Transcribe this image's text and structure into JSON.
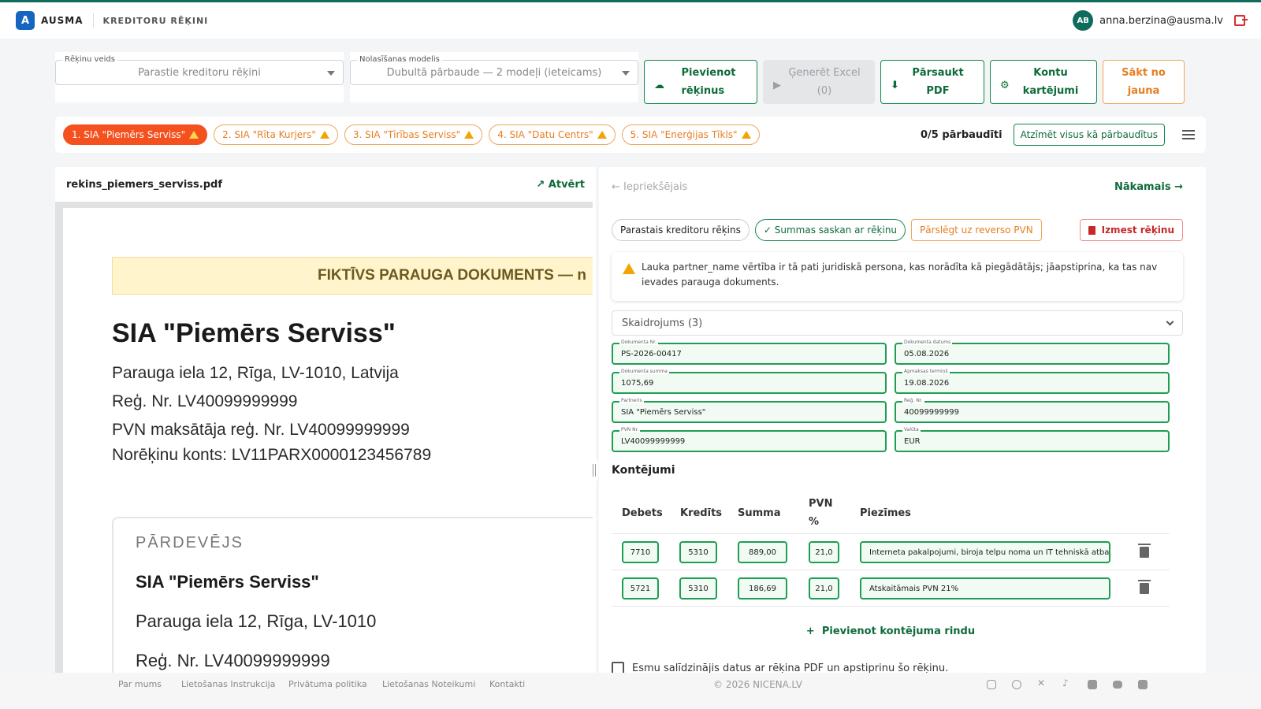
{
  "app": {
    "logo_letter": "A",
    "brand": "AUSMA",
    "section": "KREDITORU RĒĶINI",
    "user_initials": "AB",
    "user_email": "anna.berzina@ausma.lv"
  },
  "toolbar": {
    "invoice_type_label": "Rēķinu veids",
    "invoice_type_value": "Parastie kreditoru rēķini",
    "model_label": "Nolasīšanas modelis",
    "model_value": "Dubultā pārbaude — 2 modeļi (ieteicams)",
    "add_invoices_l1": "Pievienot",
    "add_invoices_l2": "rēķinus",
    "export_excel_l1": "Ģenerēt Excel",
    "export_excel_l2": "(0)",
    "reload_pdf_l1": "Pārsaukt",
    "reload_pdf_l2": "PDF",
    "account_rules_l1": "Kontu",
    "account_rules_l2": "kartējumi",
    "restart_l1": "Sākt no",
    "restart_l2": "jauna"
  },
  "invoice_tabs": [
    {
      "label": "1. SIA \"Piemērs Serviss\"",
      "active": true
    },
    {
      "label": "2. SIA \"Rīta Kurjers\"",
      "active": false
    },
    {
      "label": "3. SIA \"Tīrības Serviss\"",
      "active": false
    },
    {
      "label": "4. SIA \"Datu Centrs\"",
      "active": false
    },
    {
      "label": "5. SIA \"Enerģijas Tīkls\"",
      "active": false
    }
  ],
  "progress": "0/5 pārbaudīti",
  "mark_all": "Atzīmēt visus kā pārbaudītus",
  "pdf": {
    "filename": "rekins_piemers_serviss.pdf",
    "open": "Atvērt",
    "banner": "FIKTĪVS PARAUGA DOKUMENTS — n",
    "title": "SIA \"Piemērs Serviss\"",
    "lines": [
      "Parauga iela 12, Rīga, LV-1010, Latvija",
      "Reģ. Nr. LV40099999999",
      "PVN maksātāja reģ. Nr. LV40099999999",
      "Norēķinu konts: LV11PARX0000123456789"
    ],
    "seller_label": "PĀRDEVĒJS",
    "seller_name": "SIA \"Piemērs Serviss\"",
    "seller_address": "Parauga iela 12, Rīga, LV-1010",
    "seller_reg": "Reģ. Nr. LV40099999999"
  },
  "form": {
    "prev": "Iepriekšējais",
    "next": "Nākamais",
    "chip_type": "Parastais kreditoru rēķins",
    "chip_sums": "Summas saskan ar rēķinu",
    "chip_reverse": "Pārslēgt uz reverso PVN",
    "chip_delete": "Izmest rēķinu",
    "alert_text": "Lauka partner_name vērtība ir tā pati juridiskā persona, kas norādīta kā piegādātājs; jāapstiprina, ka tas nav ievades parauga dokuments.",
    "accordion": "Skaidrojums (3)",
    "fields": [
      {
        "label": "Dokumenta Nr.",
        "value": "PS-2026-00417"
      },
      {
        "label": "Dokumenta datums",
        "value": "05.08.2026"
      },
      {
        "label": "Dokumenta summa",
        "value": "1075,69"
      },
      {
        "label": "Apmaksas termiņš",
        "value": "19.08.2026"
      },
      {
        "label": "Partneris",
        "value": "SIA \"Piemērs Serviss\""
      },
      {
        "label": "Reģ. Nr.",
        "value": "40099999999"
      },
      {
        "label": "PVN Nr.",
        "value": "LV40099999999"
      },
      {
        "label": "Valūta",
        "value": "EUR"
      }
    ],
    "section_title": "Kontējumi",
    "columns": {
      "debit": "Debets",
      "credit": "Kredīts",
      "amount": "Summa",
      "vat_l1": "PVN",
      "vat_l2": "%",
      "notes": "Piezīmes"
    },
    "rows": [
      {
        "debit": "7710",
        "credit": "5310",
        "amount": "889,00",
        "vat": "21,0",
        "notes": "Interneta pakalpojumi, biroja telpu noma un IT tehniskā atbalsta pakalpojumi"
      },
      {
        "debit": "5721",
        "credit": "5310",
        "amount": "186,69",
        "vat": "21,0",
        "notes": "Atskaitāmais PVN 21%"
      }
    ],
    "add_row": "Pievienot kontējuma rindu",
    "confirm": "Esmu salīdzinājis datus ar rēķina PDF un apstiprinu šo rēķinu."
  },
  "footer": {
    "links": [
      "Par mums",
      "Lietošanas Instrukcija",
      "Privātuma politika",
      "Lietošanas Noteikumi",
      "Kontakti"
    ],
    "copyright": "© 2026 NICENA.LV",
    "social_icons": [
      "instagram-icon",
      "threads-icon",
      "x-icon",
      "tiktok-icon",
      "facebook-icon",
      "youtube-icon",
      "linkedin-icon"
    ]
  },
  "colors": {
    "primary": "#0f6b3a",
    "accent_orange": "#f4511e",
    "warning": "#f0a500",
    "danger": "#c62828"
  }
}
